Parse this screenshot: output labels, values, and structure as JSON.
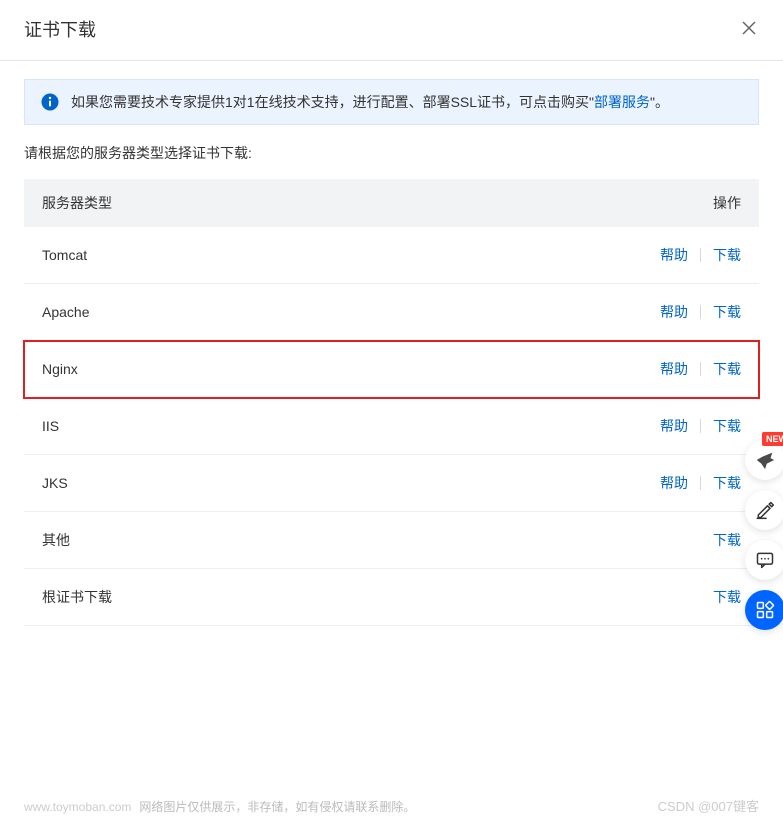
{
  "header": {
    "title": "证书下载"
  },
  "banner": {
    "text_prefix": "如果您需要技术专家提供1对1在线技术支持，进行配置、部署SSL证书，可点击购买\"",
    "link": "部署服务",
    "text_suffix": "\"。"
  },
  "instruction": "请根据您的服务器类型选择证书下载:",
  "table": {
    "columns": {
      "type": "服务器类型",
      "action": "操作"
    },
    "help_label": "帮助",
    "download_label": "下载",
    "rows": [
      {
        "type": "Tomcat",
        "help": true,
        "highlighted": false
      },
      {
        "type": "Apache",
        "help": true,
        "highlighted": false
      },
      {
        "type": "Nginx",
        "help": true,
        "highlighted": true
      },
      {
        "type": "IIS",
        "help": true,
        "highlighted": false
      },
      {
        "type": "JKS",
        "help": true,
        "highlighted": false
      },
      {
        "type": "其他",
        "help": false,
        "highlighted": false
      },
      {
        "type": "根证书下载",
        "help": false,
        "highlighted": false
      }
    ]
  },
  "side": {
    "new_badge": "NEW"
  },
  "footer": {
    "domain": "www.toymoban.com",
    "note": "网络图片仅供展示，非存储，如有侵权请联系删除。",
    "csdn": "CSDN @007键客"
  }
}
